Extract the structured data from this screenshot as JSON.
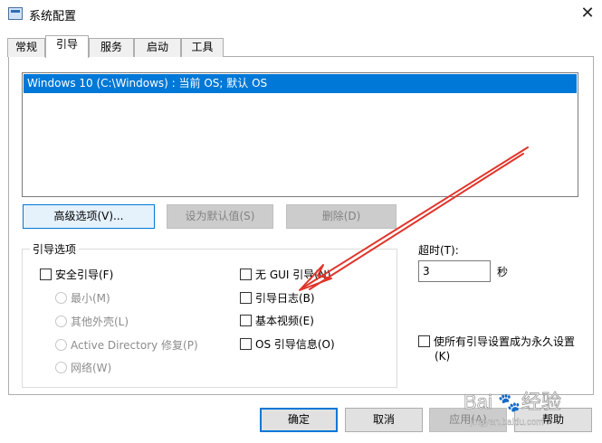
{
  "window": {
    "title": "系统配置",
    "close_glyph": "✕"
  },
  "tabs": [
    {
      "label": "常规"
    },
    {
      "label": "引导"
    },
    {
      "label": "服务"
    },
    {
      "label": "启动"
    },
    {
      "label": "工具"
    }
  ],
  "active_tab": "引导",
  "boot_list": {
    "entries": [
      "Windows 10 (C:\\Windows) : 当前 OS; 默认 OS"
    ],
    "selected_index": 0
  },
  "boot_buttons": {
    "advanced": "高级选项(V)...",
    "set_default": "设为默认值(S)",
    "delete": "删除(D)"
  },
  "boot_options": {
    "title": "引导选项",
    "safe_boot": "安全引导(F)",
    "minimal": "最小(M)",
    "alternate_shell": "其他外壳(L)",
    "active_directory_repair": "Active Directory 修复(P)",
    "network": "网络(W)",
    "no_gui_boot": "无 GUI 引导(N)",
    "boot_log": "引导日志(B)",
    "base_video": "基本视频(E)",
    "os_boot_info": "OS 引导信息(O)"
  },
  "timeout": {
    "label": "超时(T):",
    "value": "3",
    "unit": "秒"
  },
  "make_permanent": {
    "line1": "使所有引导设置成为永久设置",
    "line2": "(K)"
  },
  "footer_buttons": {
    "ok": "确定",
    "cancel": "取消",
    "apply": "应用(A)",
    "help": "帮助"
  },
  "annotation": {
    "arrow_color": "#e0342a"
  },
  "watermark": {
    "brand": "Bai",
    "paw": "🐾",
    "site": "经验",
    "url": "jingyan.baidu.com"
  },
  "colors": {
    "selection": "#0078d7",
    "button_face": "#e1e1e1"
  }
}
